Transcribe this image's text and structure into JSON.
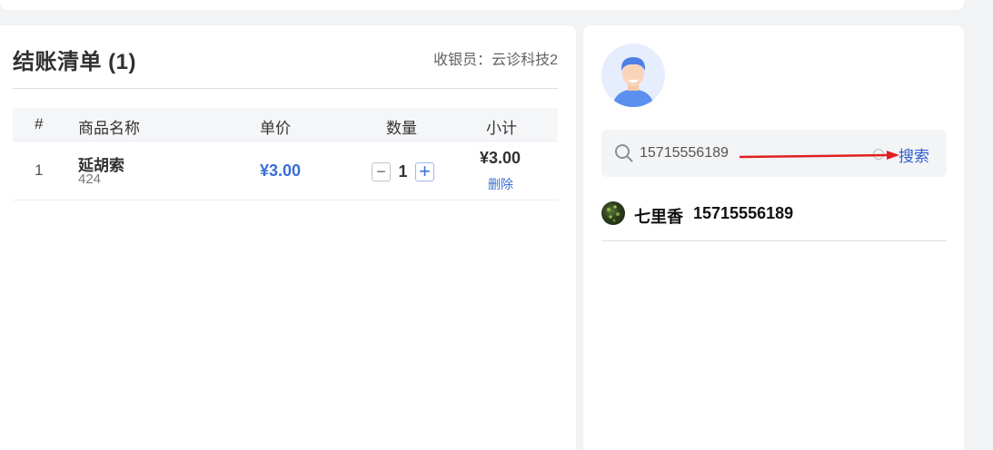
{
  "cart": {
    "title": "结账清单 (1)",
    "cashier": "收银员：云诊科技2",
    "columns": [
      "#",
      "商品名称",
      "单价",
      "数量",
      "小计"
    ],
    "rows": [
      {
        "index": "1",
        "name": "延胡索",
        "code": "424",
        "price": "¥3.00",
        "qty": "1",
        "subtotal": "¥3.00",
        "delete_label": "删除"
      }
    ],
    "qty_minus": "−",
    "qty_plus": "+"
  },
  "member": {
    "search": {
      "value": "15715556189",
      "button_label": "搜索"
    },
    "results": [
      {
        "name": "七里香",
        "phone": "15715556189"
      }
    ]
  },
  "colors": {
    "accent": "#3a6fd8",
    "annotation_arrow": "#e02020",
    "background": "#f2f3f5"
  },
  "icons": [
    "search-icon",
    "clear-icon",
    "user-avatar-icon"
  ]
}
